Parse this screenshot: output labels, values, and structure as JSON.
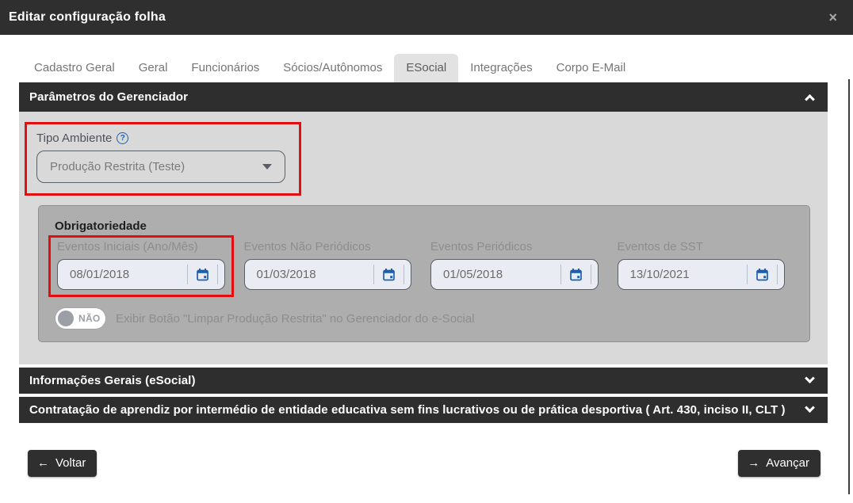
{
  "modal": {
    "title": "Editar configuração folha",
    "close_icon": "×"
  },
  "tabs": [
    {
      "label": "Cadastro Geral",
      "active": false
    },
    {
      "label": "Geral",
      "active": false
    },
    {
      "label": "Funcionários",
      "active": false
    },
    {
      "label": "Sócios/Autônomos",
      "active": false
    },
    {
      "label": "ESocial",
      "active": true
    },
    {
      "label": "Integrações",
      "active": false
    },
    {
      "label": "Corpo E-Mail",
      "active": false
    }
  ],
  "sections": {
    "parametros": {
      "title": "Parâmetros do Gerenciador",
      "state": "expanded"
    },
    "informacoes": {
      "title": "Informações Gerais (eSocial)",
      "state": "collapsed"
    },
    "contratacao": {
      "title": "Contratação de aprendiz por intermédio de entidade educativa sem fins lucrativos ou de prática desportiva ( Art. 430, inciso II, CLT )",
      "state": "collapsed"
    }
  },
  "parametros": {
    "tipo_ambiente": {
      "label": "Tipo Ambiente",
      "help_icon": "?",
      "value": "Produção Restrita (Teste)"
    },
    "obrigatoriedade": {
      "title": "Obrigatoriedade",
      "fields": [
        {
          "label": "Eventos Iniciais (Ano/Mês)",
          "value": "08/01/2018",
          "highlighted": true
        },
        {
          "label": "Eventos Não Periódicos",
          "value": "01/03/2018",
          "highlighted": false
        },
        {
          "label": "Eventos Periódicos",
          "value": "01/05/2018",
          "highlighted": false
        },
        {
          "label": "Eventos de SST",
          "value": "13/10/2021",
          "highlighted": false
        }
      ]
    },
    "toggle": {
      "state": "NÃO",
      "label": "Exibir Botão \"Limpar Produção Restrita\" no Gerenciador do e-Social"
    }
  },
  "footer": {
    "back_arrow": "←",
    "back_label": "Voltar",
    "next_arrow": "→",
    "next_label": "Avançar"
  },
  "colors": {
    "header_dark": "#2f2f2f",
    "content_gray": "#d9d9d9",
    "panel_gray": "#aeaeae",
    "highlight_red": "#e10f0f",
    "icon_blue": "#1d5fae"
  }
}
